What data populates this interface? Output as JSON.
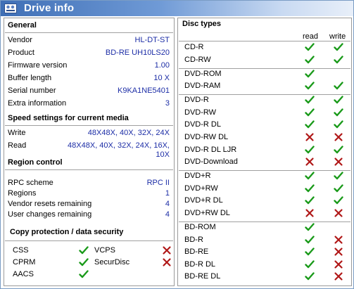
{
  "window": {
    "title": "Drive info"
  },
  "general": {
    "header": "General",
    "rows": [
      {
        "label": "Vendor",
        "value": "HL-DT-ST"
      },
      {
        "label": "Product",
        "value": "BD-RE  UH10LS20"
      },
      {
        "label": "Firmware version",
        "value": "1.00"
      },
      {
        "label": "Buffer length",
        "value": "10 X"
      },
      {
        "label": "Serial number",
        "value": "K9KA1NE5401"
      },
      {
        "label": "Extra information",
        "value": "3"
      }
    ]
  },
  "speed": {
    "header": "Speed settings for current media",
    "write_label": "Write",
    "write_value": "48X48X, 40X, 32X, 24X",
    "read_label": "Read",
    "read_value": "48X48X, 40X, 32X, 24X, 16X, 10X"
  },
  "region": {
    "header": "Region control",
    "rows": [
      {
        "label": "RPC scheme",
        "value": "RPC II"
      },
      {
        "label": "Regions",
        "value": "1"
      },
      {
        "label": "Vendor resets remaining",
        "value": "4"
      },
      {
        "label": "User changes remaining",
        "value": "4"
      }
    ]
  },
  "copy_protection": {
    "header": "Copy protection / data security",
    "items": [
      {
        "label": "CSS",
        "supported": true
      },
      {
        "label": "VCPS",
        "supported": false
      },
      {
        "label": "CPRM",
        "supported": true
      },
      {
        "label": "SecurDisc",
        "supported": false
      },
      {
        "label": "AACS",
        "supported": true
      }
    ]
  },
  "disc_types": {
    "header": "Disc types",
    "read_label": "read",
    "write_label": "write",
    "groups": [
      [
        {
          "label": "CD-R",
          "read": true,
          "write": true
        },
        {
          "label": "CD-RW",
          "read": true,
          "write": true
        }
      ],
      [
        {
          "label": "DVD-ROM",
          "read": true,
          "write": null
        },
        {
          "label": "DVD-RAM",
          "read": true,
          "write": true
        }
      ],
      [
        {
          "label": "DVD-R",
          "read": true,
          "write": true
        },
        {
          "label": "DVD-RW",
          "read": true,
          "write": true
        },
        {
          "label": "DVD-R DL",
          "read": true,
          "write": true
        },
        {
          "label": "DVD-RW DL",
          "read": false,
          "write": false
        },
        {
          "label": "DVD-R DL LJR",
          "read": true,
          "write": true
        },
        {
          "label": "DVD-Download",
          "read": false,
          "write": false
        }
      ],
      [
        {
          "label": "DVD+R",
          "read": true,
          "write": true
        },
        {
          "label": "DVD+RW",
          "read": true,
          "write": true
        },
        {
          "label": "DVD+R DL",
          "read": true,
          "write": true
        },
        {
          "label": "DVD+RW DL",
          "read": false,
          "write": false
        }
      ],
      [
        {
          "label": "BD-ROM",
          "read": true,
          "write": null
        },
        {
          "label": "BD-R",
          "read": true,
          "write": false
        },
        {
          "label": "BD-RE",
          "read": true,
          "write": false
        },
        {
          "label": "BD-R DL",
          "read": true,
          "write": false
        },
        {
          "label": "BD-RE DL",
          "read": true,
          "write": false
        }
      ]
    ]
  },
  "colors": {
    "check": "#1a9a1a",
    "cross": "#b01818",
    "value_text": "#1c2da6",
    "title_gradient_start": "#3f6fb6"
  },
  "icons": {
    "title": "drive-info-icon",
    "yes": "check-icon",
    "no": "cross-icon"
  }
}
